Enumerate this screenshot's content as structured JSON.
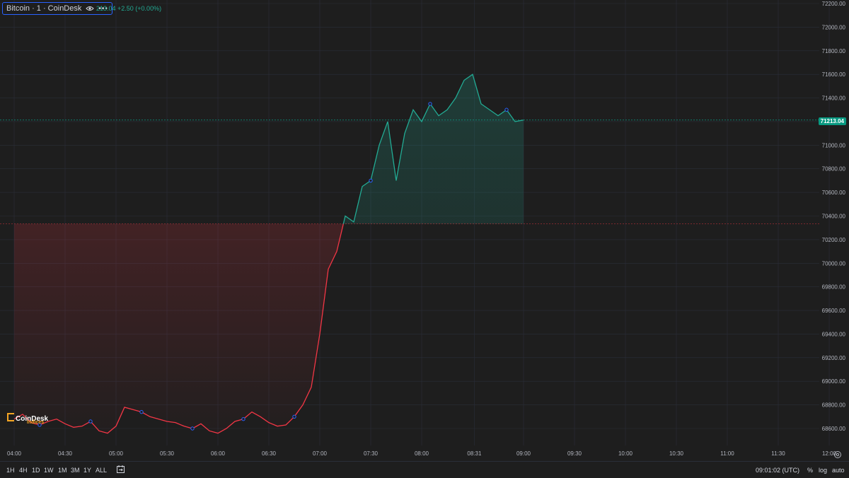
{
  "legend": {
    "symbol": "Bitcoin · 1 · CoinDesk",
    "values": "213.04  +2.50 (+0.00%)",
    "eye_icon": "eye-icon",
    "more_icon": "more-dots-icon"
  },
  "price_axis": {
    "ticks": [
      "72200.00",
      "72000.00",
      "71800.00",
      "71600.00",
      "71400.00",
      "71200.00",
      "71000.00",
      "70800.00",
      "70600.00",
      "70400.00",
      "70200.00",
      "70000.00",
      "69800.00",
      "69600.00",
      "69400.00",
      "69200.00",
      "69000.00",
      "68800.00",
      "68600.00"
    ],
    "last_price": "71213.04",
    "last_price_color": "#089981"
  },
  "time_axis": {
    "ticks": [
      "04:00",
      "04:30",
      "05:00",
      "05:30",
      "06:00",
      "06:30",
      "07:00",
      "07:30",
      "08:00",
      "08:31",
      "09:00",
      "09:30",
      "10:00",
      "10:30",
      "11:00",
      "11:30",
      "12:00"
    ]
  },
  "watermark": {
    "brand": "CoinDesk",
    "sub": "Indices"
  },
  "bottom_bar": {
    "ranges": [
      "1H",
      "4H",
      "1D",
      "1W",
      "1M",
      "3M",
      "1Y",
      "ALL"
    ],
    "calendar_icon": "calendar-goto-icon",
    "clock": "09:01:02 (UTC)",
    "percent": "%",
    "log": "log",
    "auto": "auto"
  },
  "settings_icon": "settings-gear-icon",
  "colors": {
    "up": "#22ab94",
    "down": "#f23645",
    "background": "#1e1e1e",
    "grid": "#2a2e39"
  },
  "chart_data": {
    "type": "area",
    "baseline": 70333,
    "x": [
      "04:00",
      "04:05",
      "04:10",
      "04:15",
      "04:20",
      "04:25",
      "04:30",
      "04:35",
      "04:40",
      "04:45",
      "04:50",
      "04:55",
      "05:00",
      "05:05",
      "05:10",
      "05:15",
      "05:20",
      "05:25",
      "05:30",
      "05:35",
      "05:40",
      "05:45",
      "05:50",
      "05:55",
      "06:00",
      "06:05",
      "06:10",
      "06:15",
      "06:20",
      "06:25",
      "06:30",
      "06:35",
      "06:40",
      "06:45",
      "06:50",
      "06:55",
      "07:00",
      "07:05",
      "07:10",
      "07:15",
      "07:20",
      "07:25",
      "07:30",
      "07:35",
      "07:40",
      "07:45",
      "07:50",
      "07:55",
      "08:00",
      "08:05",
      "08:10",
      "08:15",
      "08:20",
      "08:25",
      "08:30",
      "08:35",
      "08:40",
      "08:45",
      "08:50",
      "08:55",
      "09:00"
    ],
    "values": [
      68680,
      68720,
      68650,
      68630,
      68660,
      68680,
      68640,
      68610,
      68620,
      68660,
      68580,
      68560,
      68620,
      68780,
      68760,
      68740,
      68700,
      68680,
      68660,
      68650,
      68620,
      68600,
      68640,
      68580,
      68560,
      68600,
      68660,
      68680,
      68740,
      68700,
      68650,
      68620,
      68630,
      68700,
      68800,
      68950,
      69400,
      69950,
      70100,
      70400,
      70350,
      70650,
      70700,
      71000,
      71200,
      70700,
      71100,
      71300,
      71200,
      71350,
      71250,
      71300,
      71400,
      71550,
      71600,
      71350,
      71300,
      71250,
      71300,
      71200,
      71213
    ],
    "markers": [
      "04:15",
      "04:45",
      "05:15",
      "05:45",
      "06:15",
      "06:45",
      "07:30",
      "08:05",
      "08:50"
    ],
    "ylim": [
      68500,
      72220
    ],
    "xlabel": "",
    "ylabel": ""
  }
}
